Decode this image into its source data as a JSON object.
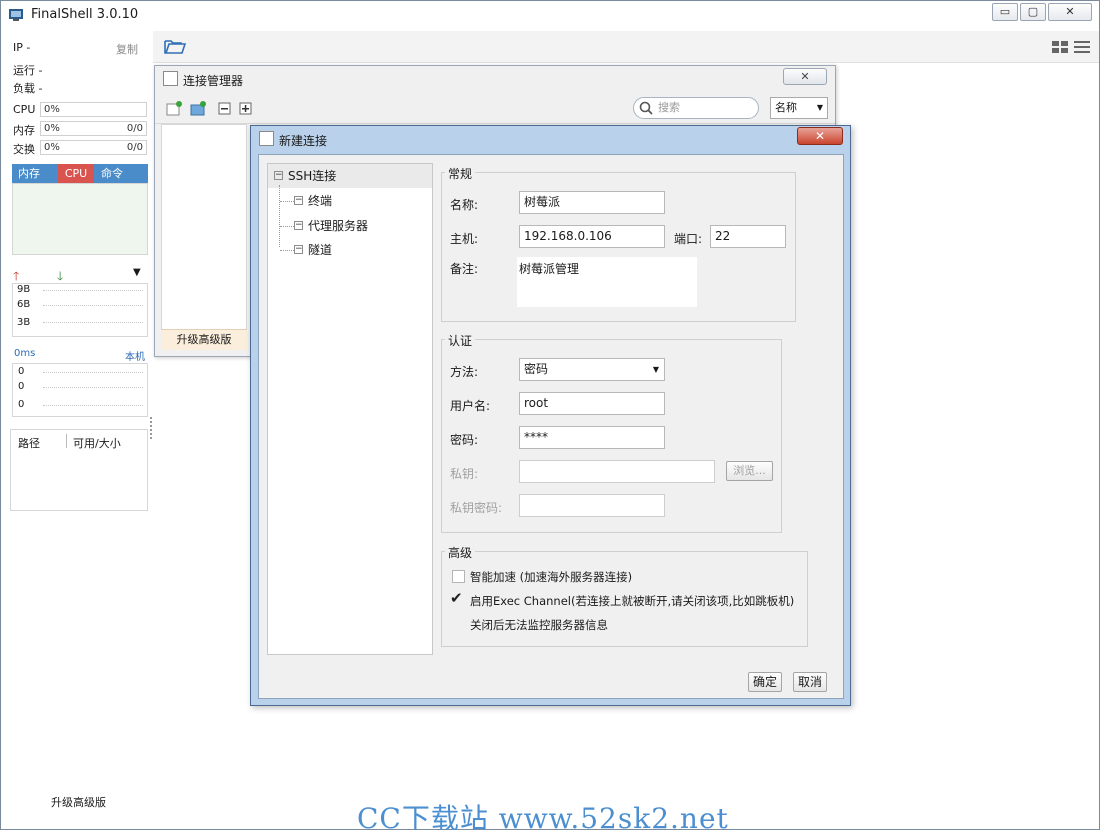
{
  "window": {
    "title": "FinalShell 3.0.10",
    "minimize": "▭",
    "restore": "▢",
    "close": "✕"
  },
  "sidebar": {
    "ip_label": "IP -",
    "copy": "复制",
    "run": "运行 -",
    "load": "负载 -",
    "meters": [
      {
        "label": "CPU",
        "value": "0%",
        "extra": ""
      },
      {
        "label": "内存",
        "value": "0%",
        "extra": "0/0"
      },
      {
        "label": "交换",
        "value": "0%",
        "extra": "0/0"
      }
    ],
    "tabs": [
      "内存",
      "CPU",
      "命令"
    ],
    "net_ticks": [
      "9B",
      "6B",
      "3B"
    ],
    "latency": "0ms",
    "host": "本机",
    "latency_ticks": [
      "0",
      "0",
      "0"
    ],
    "disk_headers": [
      "路径",
      "可用/大小"
    ],
    "upgrade": "升级高级版"
  },
  "conn_manager": {
    "title": "连接管理器",
    "search_placeholder": "搜索",
    "sort": "名称",
    "upgrade": "升级高级版"
  },
  "new_conn": {
    "title": "新建连接",
    "tree": {
      "root": "SSH连接",
      "children": [
        "终端",
        "代理服务器",
        "隧道"
      ]
    },
    "general": {
      "legend": "常规",
      "name_label": "名称:",
      "name_value": "树莓派",
      "host_label": "主机:",
      "host_value": "192.168.0.106",
      "port_label": "端口:",
      "port_value": "22",
      "note_label": "备注:",
      "note_value": "树莓派管理"
    },
    "auth": {
      "legend": "认证",
      "method_label": "方法:",
      "method_value": "密码",
      "user_label": "用户名:",
      "user_value": "root",
      "pass_label": "密码:",
      "pass_value": "****",
      "key_label": "私钥:",
      "browse": "浏览...",
      "keypass_label": "私钥密码:"
    },
    "advanced": {
      "legend": "高级",
      "accel_label": "智能加速 (加速海外服务器连接)",
      "accel_checked": false,
      "exec_label": "启用Exec Channel(若连接上就被断开,请关闭该项,比如跳板机)",
      "exec_checked": true,
      "exec_note": "关闭后无法监控服务器信息"
    },
    "ok": "确定",
    "cancel": "取消"
  },
  "watermark": "CC下载站 www.52sk2.net",
  "colors": {
    "accent": "#4a8bc9",
    "cpu_tab": "#d9534f",
    "title_close": "#c9452f"
  }
}
